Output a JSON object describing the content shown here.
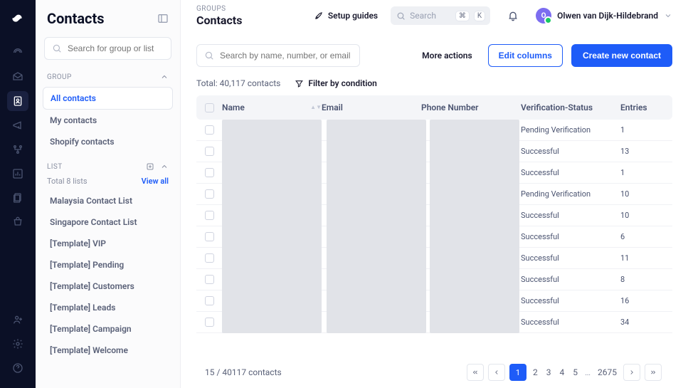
{
  "sidebar": {
    "title": "Contacts",
    "search_placeholder": "Search for group or list",
    "group_label": "GROUP",
    "list_label": "LIST",
    "list_total": "Total 8 lists",
    "view_all": "View all",
    "groups": [
      {
        "label": "All contacts"
      },
      {
        "label": "My contacts"
      },
      {
        "label": "Shopify contacts"
      }
    ],
    "lists": [
      {
        "label": "Malaysia Contact List"
      },
      {
        "label": "Singapore Contact List"
      },
      {
        "label": "[Template] VIP"
      },
      {
        "label": "[Template] Pending"
      },
      {
        "label": "[Template] Customers"
      },
      {
        "label": "[Template] Leads"
      },
      {
        "label": "[Template] Campaign"
      },
      {
        "label": "[Template] Welcome"
      }
    ]
  },
  "header": {
    "breadcrumb": "GROUPS",
    "title": "Contacts",
    "setup_guides": "Setup guides",
    "search_placeholder": "Search",
    "shortcut1": "⌘",
    "shortcut2": "K",
    "user_initial": "O",
    "user_name": "Olwen van Dijk-Hildebrand"
  },
  "actions": {
    "search_placeholder": "Search by name, number, or email",
    "more": "More actions",
    "edit_columns": "Edit columns",
    "create": "Create new contact"
  },
  "meta": {
    "total": "Total: 40,117 contacts",
    "filter": "Filter by condition"
  },
  "table": {
    "headers": {
      "name": "Name",
      "email": "Email",
      "phone": "Phone Number",
      "status": "Verification-Status",
      "entries": "Entries"
    },
    "rows": [
      {
        "status": "Pending Verification",
        "entries": "1"
      },
      {
        "status": "Successful",
        "entries": "13"
      },
      {
        "status": "Successful",
        "entries": "1"
      },
      {
        "status": "Pending Verification",
        "entries": "10"
      },
      {
        "status": "Successful",
        "entries": "10"
      },
      {
        "status": "Successful",
        "entries": "6"
      },
      {
        "status": "Successful",
        "entries": "11"
      },
      {
        "status": "Successful",
        "entries": "8"
      },
      {
        "status": "Successful",
        "entries": "16"
      },
      {
        "status": "Successful",
        "entries": "34"
      }
    ]
  },
  "pager": {
    "summary": "15 / 40117 contacts",
    "pages": [
      "1",
      "2",
      "3",
      "4",
      "5"
    ],
    "last": "2675"
  }
}
